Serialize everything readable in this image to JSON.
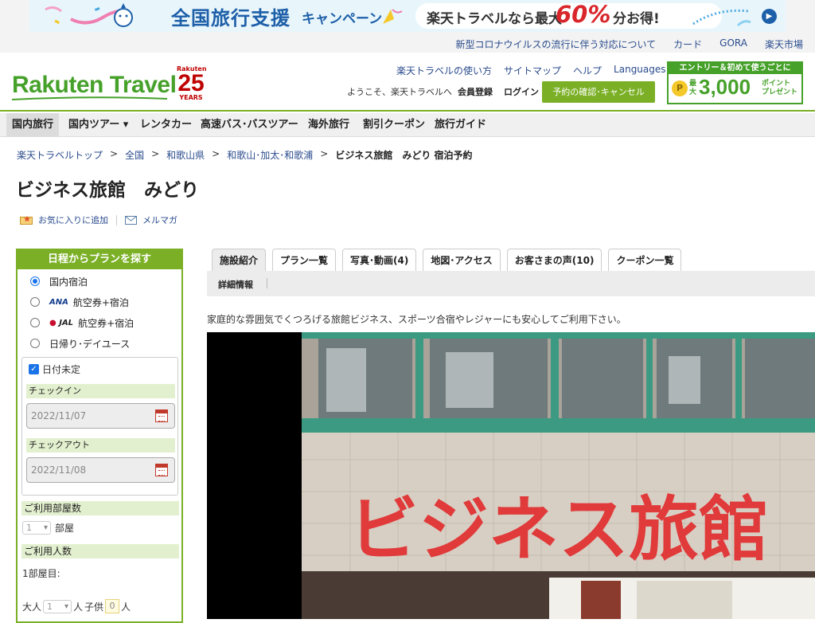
{
  "banner": {
    "title": "全国旅行支援",
    "campaign": "キャンペーン",
    "offer": "楽天トラベルなら最大",
    "percent": "60%",
    "rest": "分お得!",
    "arrow": "▶"
  },
  "topnav": {
    "links": [
      "新型コロナウイルスの流行に伴う対応について",
      "カード",
      "GORA",
      "楽天市場"
    ]
  },
  "header": {
    "logo": "Rakuten Travel",
    "anniv_brand": "Rakuten",
    "anniv_number": "25",
    "anniv_years": "YEARS",
    "links": [
      "楽天トラベルの使い方",
      "サイトマップ",
      "ヘルプ",
      "Languages ▾"
    ],
    "welcome": "ようこそ、楽天トラベルへ",
    "register": "会員登録",
    "login": "ログイン",
    "reservation_button": "予約の確認･キャンセル",
    "promo_top": "エントリー＆初めて使うごとに",
    "promo_coin": "P",
    "promo_max": "最大",
    "promo_number": "3,000",
    "promo_points": "ポイント",
    "promo_present": "プレゼント"
  },
  "mainnav": {
    "items": [
      "国内旅行",
      "国内ツアー ▾",
      "レンタカー",
      "高速バス･バスツアー",
      "海外旅行",
      "割引クーポン",
      "旅行ガイド"
    ]
  },
  "breadcrumb": {
    "items": [
      "楽天トラベルトップ",
      "全国",
      "和歌山県",
      "和歌山･加太･和歌浦"
    ],
    "current": "ビジネス旅館　みどり 宿泊予約",
    "separator": ">"
  },
  "hotel": {
    "name": "ビジネス旅館　みどり",
    "favorite": "お気に入りに追加",
    "mailmag": "メルマガ",
    "intro": "家庭的な雰囲気でくつろげる旅館ビジネス、スポーツ合宿やレジャーにも安心してご利用下さい。",
    "sign_text": "ビジネス旅館"
  },
  "search": {
    "title": "日程からプランを探す",
    "options": [
      "国内宿泊",
      "航空券+宿泊",
      "航空券+宿泊",
      "日帰り･デイユース"
    ],
    "ana": "ANA",
    "jal": "JAL",
    "date_undecided": "日付未定",
    "checkin_label": "チェックイン",
    "checkin_value": "2022/11/07",
    "checkout_label": "チェックアウト",
    "checkout_value": "2022/11/08",
    "rooms_label": "ご利用部屋数",
    "rooms_value": "1",
    "rooms_unit": "部屋",
    "people_label": "ご利用人数",
    "room1": "1部屋目:",
    "adult_label": "大人",
    "adult_value": "1",
    "person_unit": "人",
    "child_label": "子供",
    "child_value": "0",
    "child_unit": "人"
  },
  "tabs": {
    "items": [
      "施設紹介",
      "プラン一覧",
      "写真･動画(4)",
      "地図･アクセス",
      "お客さまの声(10)",
      "クーポン一覧"
    ],
    "sub": "詳細情報"
  },
  "colors": {
    "brand_green": "#7bb026",
    "logo_green": "#46a12a",
    "link_blue": "#2a4b8d",
    "accent_red": "#d8262b"
  }
}
